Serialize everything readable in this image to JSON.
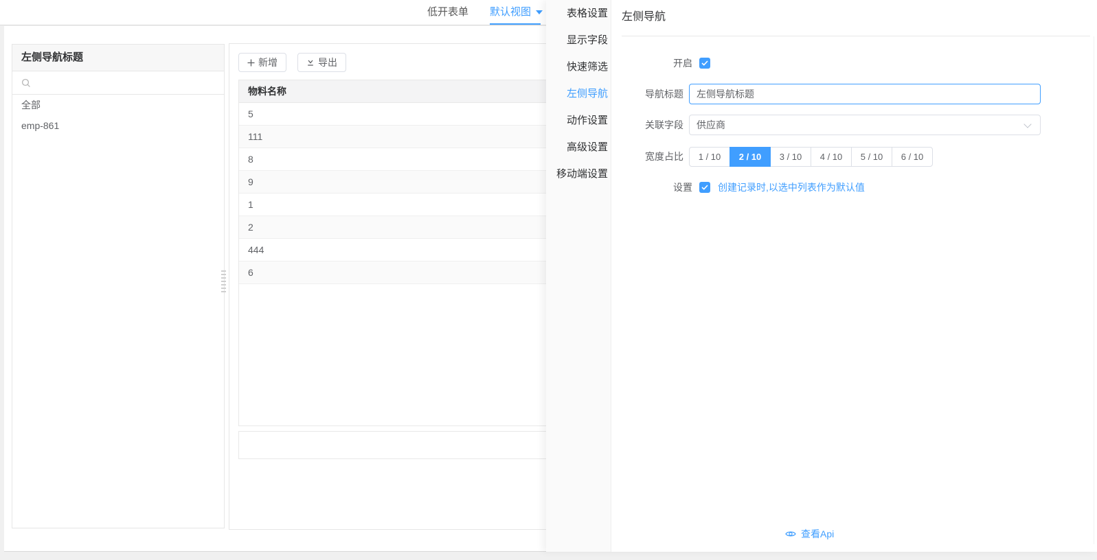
{
  "accent_color": "#409eff",
  "topbar": {
    "tabs": [
      {
        "label": "低开表单",
        "active": false
      },
      {
        "label": "默认视图",
        "active": true
      }
    ]
  },
  "left_nav_panel": {
    "title": "左侧导航标题",
    "search_placeholder": "",
    "items": [
      {
        "label": "全部"
      },
      {
        "label": "emp-861"
      }
    ]
  },
  "table_panel": {
    "toolbar": {
      "add_label": "新增",
      "export_label": "导出"
    },
    "table": {
      "columns": [
        "物料名称"
      ],
      "rows": [
        "5",
        "111",
        "8",
        "9",
        "1",
        "2",
        "444",
        "6"
      ]
    }
  },
  "settings_drawer": {
    "menu": [
      {
        "label": "表格设置",
        "active": false
      },
      {
        "label": "显示字段",
        "active": false
      },
      {
        "label": "快速筛选",
        "active": false
      },
      {
        "label": "左侧导航",
        "active": true
      },
      {
        "label": "动作设置",
        "active": false
      },
      {
        "label": "高级设置",
        "active": false
      },
      {
        "label": "移动端设置",
        "active": false
      }
    ],
    "panel_title": "左侧导航",
    "form": {
      "enable": {
        "label": "开启",
        "checked": true
      },
      "nav_title": {
        "label": "导航标题",
        "value": "左侧导航标题"
      },
      "related_field": {
        "label": "关联字段",
        "value": "供应商"
      },
      "width_ratio": {
        "label": "宽度占比",
        "options": [
          "1 / 10",
          "2 / 10",
          "3 / 10",
          "4 / 10",
          "5 / 10",
          "6 / 10"
        ],
        "selected": "2 / 10"
      },
      "setting": {
        "label": "设置",
        "checked": true,
        "text": "创建记录时,以选中列表作为默认值"
      }
    },
    "api_link_label": "查看Api"
  }
}
